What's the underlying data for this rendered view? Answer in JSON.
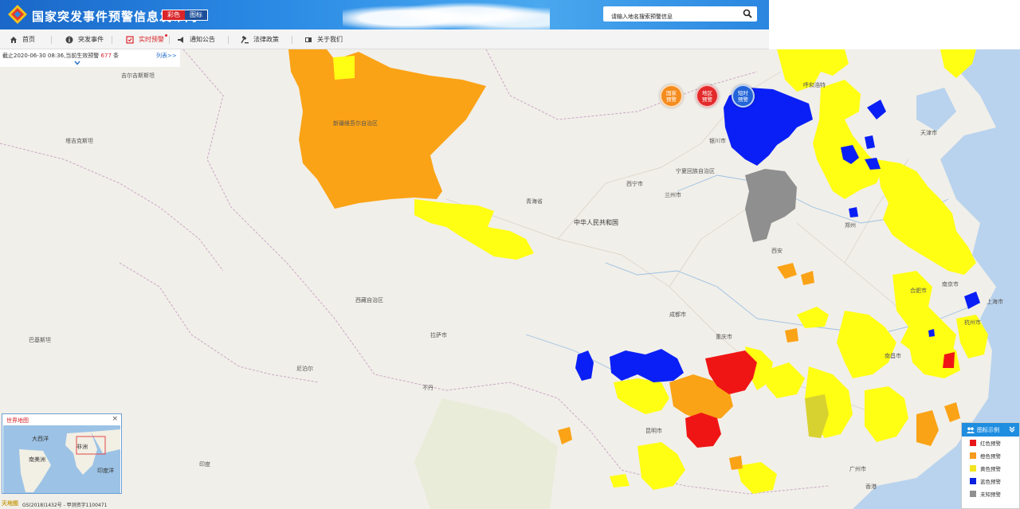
{
  "header": {
    "site_title": "国家突发事件预警信息发布网",
    "lang_color": "彩色",
    "lang_bw": "图标",
    "search_placeholder": "请输入地名搜索预警信息"
  },
  "nav": {
    "items": [
      {
        "label": "首页",
        "icon": "home-icon"
      },
      {
        "label": "突发事件",
        "icon": "info-icon"
      },
      {
        "label": "实时预警",
        "icon": "realtime-icon",
        "active": true
      },
      {
        "label": "通知公告",
        "icon": "megaphone-icon"
      },
      {
        "label": "法律政策",
        "icon": "gavel-icon"
      },
      {
        "label": "关于我们",
        "icon": "about-icon"
      }
    ]
  },
  "info": {
    "prefix": "截止2020-06-30 08:36,当前生效预警",
    "count": "677",
    "suffix": "条",
    "list_link": "列表>>"
  },
  "buttons": {
    "national": "国家\n预警",
    "provincial": "地区\n预警",
    "shortterm": "短时\n预警"
  },
  "map_labels": {
    "china": "中华人民共和国",
    "lhasa": "拉萨市",
    "xining": "西宁市",
    "lanzhou": "兰州市",
    "chengdu": "成都市",
    "chongqing": "重庆市",
    "kunming": "昆明市",
    "guangzhou": "广州市",
    "shanghai": "上海市",
    "hangzhou": "杭州市",
    "nanjing": "南京市",
    "tianjin": "天津市",
    "hohhot": "呼和浩特",
    "yinchuan": "银川市",
    "zhengzhou": "郑州",
    "nanchang": "南昌市",
    "hefei": "合肥市",
    "hongkong": "香港",
    "nepal": "尼泊尔",
    "bhutan": "不丹",
    "india": "印度",
    "pakistan": "巴基斯坦",
    "kyrgyzstan": "吉尔吉斯斯坦",
    "tajikistan": "塔吉克斯坦",
    "qinghai": "青海省",
    "tibet": "西藏自治区",
    "ningxia": "宁夏回族自治区",
    "xian": "西安",
    "xinjiang_bg": "新疆维吾尔自治区"
  },
  "minimap": {
    "title": "世界地图",
    "close": "×",
    "atlantic": "大西洋",
    "africa": "非洲",
    "south_america": "南美洲",
    "indian_ocean": "印度洋"
  },
  "footer": {
    "logo": "天地图",
    "text": "GS(2018)1432号 - 甲测资字1100471"
  },
  "legend": {
    "title": "图标示例",
    "items": [
      {
        "label": "红色预警",
        "color": "#e8171a"
      },
      {
        "label": "橙色预警",
        "color": "#f59a1c"
      },
      {
        "label": "黄色预警",
        "color": "#f2e51f"
      },
      {
        "label": "蓝色预警",
        "color": "#0b21e0"
      },
      {
        "label": "未知预警",
        "color": "#909090"
      }
    ]
  },
  "colors": {
    "red": "#f01515",
    "orange": "#fba316",
    "yellow": "#ffff14",
    "blue": "#0a1ff5",
    "gray": "#8f8f8f"
  }
}
